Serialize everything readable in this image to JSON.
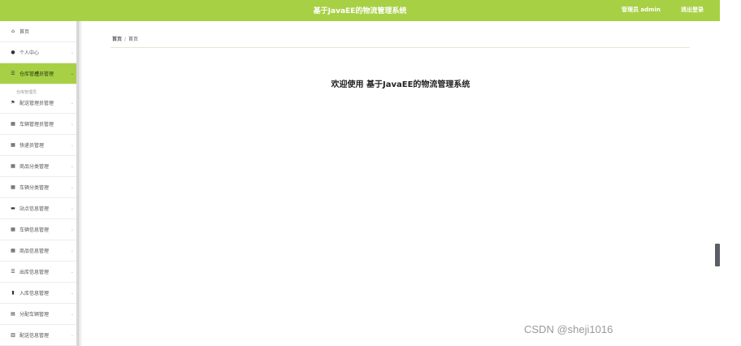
{
  "header": {
    "title": "基于JavaEE的物流管理系统",
    "user_label": "管理员 admin",
    "logout_label": "退出登录"
  },
  "sidebar": {
    "items": [
      {
        "label": "首页",
        "icon": "home-icon",
        "glyph": "⌂"
      },
      {
        "label": "个人中心",
        "icon": "user-icon",
        "glyph": "●"
      },
      {
        "label": "仓库管理员管理",
        "icon": "list-icon",
        "glyph": "☰",
        "active": true
      },
      {
        "label": "配送管理员管理",
        "icon": "flag-icon",
        "glyph": "⚑"
      },
      {
        "label": "车辆管理员管理",
        "icon": "grid-icon",
        "glyph": "▦"
      },
      {
        "label": "快递员管理",
        "icon": "grid-icon",
        "glyph": "▦"
      },
      {
        "label": "商品分类管理",
        "icon": "grid-icon",
        "glyph": "▦"
      },
      {
        "label": "车辆分类管理",
        "icon": "grid-icon",
        "glyph": "▦"
      },
      {
        "label": "站点信息管理",
        "icon": "briefcase-icon",
        "glyph": "▬"
      },
      {
        "label": "车辆信息管理",
        "icon": "grid-icon",
        "glyph": "▦"
      },
      {
        "label": "商品信息管理",
        "icon": "grid-icon",
        "glyph": "▦"
      },
      {
        "label": "出库信息管理",
        "icon": "list-icon",
        "glyph": "☰"
      },
      {
        "label": "入库信息管理",
        "icon": "bar-chart-icon",
        "glyph": "▮"
      },
      {
        "label": "分配车辆管理",
        "icon": "archive-icon",
        "glyph": "▤"
      },
      {
        "label": "配送信息管理",
        "icon": "trash-icon",
        "glyph": "▥"
      }
    ],
    "submenu_label": "仓库管理员"
  },
  "breadcrumb": {
    "home": "首页",
    "separator": "/",
    "current": "首页"
  },
  "main": {
    "welcome": "欢迎使用 基于JavaEE的物流管理系统"
  },
  "watermark": "CSDN @sheji1016"
}
